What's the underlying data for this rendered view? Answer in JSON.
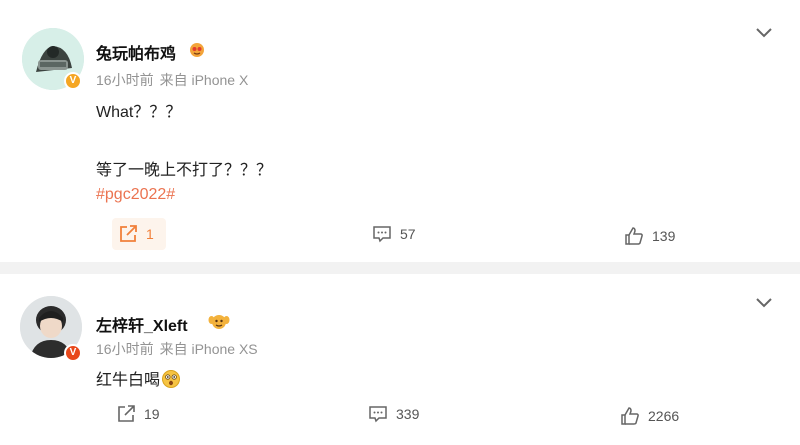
{
  "colors": {
    "accent_orange": "#f1803a",
    "hashtag": "#eb7350",
    "meta_gray": "#939393",
    "verified_gold": "#f5a623",
    "verified_red": "#e8481b"
  },
  "posts": [
    {
      "username": "兔玩帕布鸡",
      "time": "16小时前",
      "source": "来自 iPhone X",
      "verified_badge": "V",
      "lines": [
        "What？？？",
        "等了一晚上不打了？？？"
      ],
      "hashtag": "#pgc2022#",
      "actions": {
        "forward": "1",
        "comment": "57",
        "like": "139"
      }
    },
    {
      "username": "左梓轩_Xleft",
      "time": "16小时前",
      "source": "来自 iPhone XS",
      "verified_badge": "V",
      "lines": [
        "红牛白喝"
      ],
      "actions": {
        "forward": "19",
        "comment": "339",
        "like": "2266"
      }
    }
  ]
}
